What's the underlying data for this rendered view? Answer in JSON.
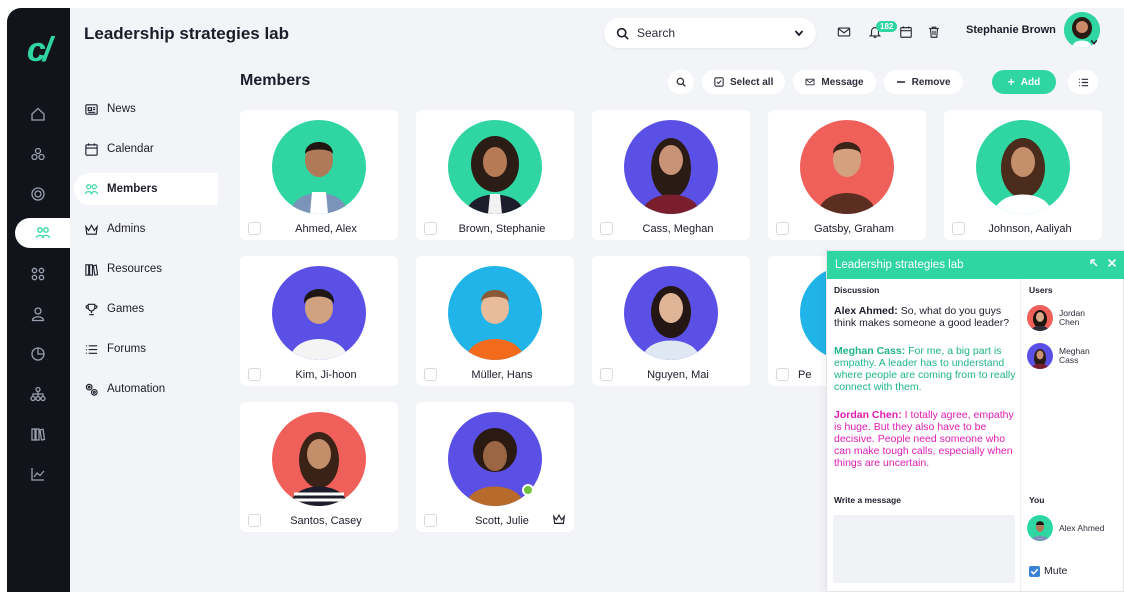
{
  "app": {
    "title": "Leadership strategies lab"
  },
  "topbar": {
    "search_label": "Search",
    "notification_count": "182",
    "user_name": "Stephanie Brown"
  },
  "subnav": {
    "items": [
      {
        "label": "News",
        "icon": "news-icon"
      },
      {
        "label": "Calendar",
        "icon": "calendar-icon"
      },
      {
        "label": "Members",
        "icon": "members-icon",
        "active": true
      },
      {
        "label": "Admins",
        "icon": "crown-icon"
      },
      {
        "label": "Resources",
        "icon": "books-icon"
      },
      {
        "label": "Games",
        "icon": "trophy-icon"
      },
      {
        "label": "Forums",
        "icon": "list-icon"
      },
      {
        "label": "Automation",
        "icon": "gears-icon"
      }
    ]
  },
  "members": {
    "title": "Members",
    "actions": {
      "select_all": "Select all",
      "message": "Message",
      "remove": "Remove",
      "add": "Add"
    },
    "cards": [
      {
        "name": "Ahmed, Alex",
        "bg": "#2fd6a1"
      },
      {
        "name": "Brown, Stephanie",
        "bg": "#2fd6a1"
      },
      {
        "name": "Cass, Meghan",
        "bg": "#5b50e6"
      },
      {
        "name": "Gatsby, Graham",
        "bg": "#f0605b"
      },
      {
        "name": "Johnson, Aaliyah",
        "bg": "#2fd6a1"
      },
      {
        "name": "Kim, Ji-hoon",
        "bg": "#5b50e6"
      },
      {
        "name": "Müller, Hans",
        "bg": "#21b4e8"
      },
      {
        "name": "Nguyen, Mai",
        "bg": "#5b50e6"
      },
      {
        "name": "Pe",
        "bg": "#21b4e8"
      },
      {
        "name": "Santos, Casey",
        "bg": "#f0605b"
      },
      {
        "name": "Scott, Julie",
        "bg": "#5b50e6"
      }
    ]
  },
  "chat": {
    "title": "Leadership strategies lab",
    "discussion_label": "Discussion",
    "users_label": "Users",
    "write_label": "Write a message",
    "you_label": "You",
    "mute_label": "Mute",
    "messages": [
      {
        "author": "Alex Ahmed",
        "text": "So, what do you guys think makes someone a good leader?",
        "color": "#1d1d2b"
      },
      {
        "author": "Meghan Cass",
        "text": "For me, a big part is empathy. A leader has to understand where people are coming from to really connect with them.",
        "color": "#1fb58a"
      },
      {
        "author": "Jordan Chen",
        "text": "I totally agree, empathy is huge. But they also have to be decisive. People need someone who can make tough calls, especially when things are uncertain.",
        "color": "#e21cb4"
      }
    ],
    "users": [
      {
        "name_line1": "Jordan",
        "name_line2": "Chen"
      },
      {
        "name_line1": "Meghan",
        "name_line2": "Cass"
      }
    ],
    "you": {
      "name": "Alex Ahmed"
    }
  },
  "colors": {
    "accent": "#2fd6a1",
    "rail": "#12141c",
    "purple": "#5b50e6",
    "coral": "#f0605b",
    "sky": "#21b4e8"
  }
}
